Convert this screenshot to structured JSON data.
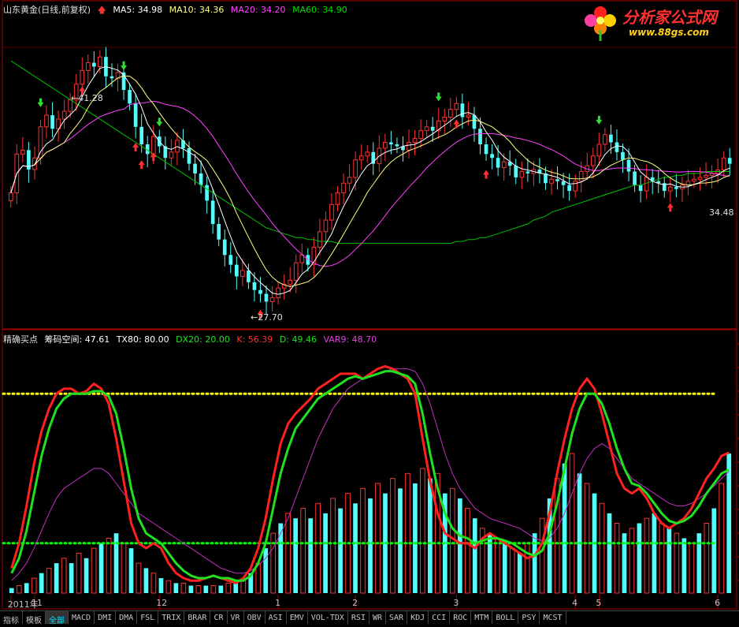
{
  "header": {
    "stock": "山东黄金(日线,前复权)",
    "ma5": "MA5: 34.98",
    "ma10": "MA10: 34.36",
    "ma20": "MA20: 34.20",
    "ma60": "MA60: 34.90"
  },
  "indicator_header": {
    "name": "精确买点",
    "zone": "筹码空间: 47.61",
    "tx80": "TX80: 80.00",
    "dx20": "DX20: 20.00",
    "k": "K: 56.39",
    "d": "D: 49.46",
    "var9": "VAR9: 48.70"
  },
  "logo": {
    "title": "分析家公式网",
    "url": "www.88gs.com"
  },
  "price_labels": {
    "high": "41.28",
    "low": "27.70",
    "last": "34.48"
  },
  "colors": {
    "up": "#ff3030",
    "down": "#54fcfc",
    "ma5": "#ffffff",
    "ma10": "#ffff80",
    "ma20": "#ff40ff",
    "ma60": "#00c000",
    "k": "#ff2020",
    "d": "#20e020",
    "var9": "#c030c0",
    "ref": "#ffff00",
    "ref2": "#00ff00"
  },
  "tabs": [
    "指标",
    "模板",
    "全部",
    "MACD",
    "DMI",
    "DMA",
    "FSL",
    "TRIX",
    "BRAR",
    "CR",
    "VR",
    "OBV",
    "ASI",
    "EMV",
    "VOL-TDX",
    "RSI",
    "WR",
    "SAR",
    "KDJ",
    "CCI",
    "ROC",
    "MTM",
    "BOLL",
    "PSY",
    "MCST"
  ],
  "active_tab": "全部",
  "chart_data": [
    {
      "type": "candlestick",
      "title": "山东黄金(日线,前复权)",
      "ylim": [
        27,
        43
      ],
      "x_labels": [
        {
          "label": "2011年",
          "index": 0
        },
        {
          "label": "11",
          "index": 4
        },
        {
          "label": "12",
          "index": 25
        },
        {
          "label": "1",
          "index": 45
        },
        {
          "label": "2",
          "index": 58
        },
        {
          "label": "3",
          "index": 75
        },
        {
          "label": "4",
          "index": 95
        },
        {
          "label": "5",
          "index": 99
        },
        {
          "label": "6",
          "index": 119
        }
      ],
      "close": [
        33.8,
        35.8,
        36.0,
        35.0,
        35.6,
        37.2,
        37.8,
        37.1,
        37.6,
        38.0,
        38.6,
        39.4,
        40.1,
        40.5,
        40.3,
        40.8,
        39.8,
        39.7,
        40.0,
        39.1,
        38.4,
        37.2,
        36.3,
        35.8,
        36.7,
        36.2,
        35.6,
        35.9,
        36.5,
        36.1,
        35.3,
        34.8,
        34.2,
        33.4,
        32.2,
        31.4,
        30.6,
        30.1,
        29.5,
        29.8,
        29.2,
        28.8,
        28.6,
        28.2,
        28.4,
        28.9,
        29.1,
        29.3,
        30.2,
        30.6,
        30.1,
        31.0,
        31.8,
        32.4,
        33.2,
        33.8,
        34.3,
        34.6,
        35.5,
        35.7,
        35.9,
        35.3,
        36.1,
        36.4,
        36.3,
        36.2,
        36.0,
        36.4,
        36.6,
        37.0,
        37.2,
        37.0,
        37.5,
        37.7,
        38.1,
        38.4,
        37.7,
        37.8,
        37.1,
        36.3,
        35.8,
        35.6,
        35.1,
        35.4,
        35.2,
        34.6,
        34.9,
        34.8,
        35.0,
        34.8,
        34.3,
        34.5,
        34.4,
        34.2,
        33.9,
        34.4,
        34.9,
        35.2,
        35.7,
        36.3,
        36.8,
        36.4,
        35.9,
        35.5,
        34.9,
        34.2,
        33.9,
        34.6,
        34.4,
        34.3,
        33.9,
        34.1,
        34.0,
        34.2,
        34.4,
        34.5,
        34.6,
        34.7,
        34.8,
        34.98,
        35.6,
        35.3
      ],
      "ma60": [
        40.6,
        40.4,
        40.2,
        40.0,
        39.8,
        39.6,
        39.4,
        39.2,
        39.0,
        38.8,
        38.6,
        38.4,
        38.2,
        38.0,
        37.8,
        37.6,
        37.4,
        37.2,
        37.0,
        36.8,
        36.6,
        36.4,
        36.2,
        36.0,
        35.8,
        35.6,
        35.4,
        35.2,
        35.0,
        34.8,
        34.6,
        34.4,
        34.2,
        34.0,
        33.8,
        33.6,
        33.4,
        33.2,
        33.0,
        32.8,
        32.6,
        32.4,
        32.2,
        32.0,
        31.9,
        31.8,
        31.7,
        31.6,
        31.5,
        31.5,
        31.4,
        31.4,
        31.3,
        31.3,
        31.3,
        31.2,
        31.2,
        31.2,
        31.2,
        31.2,
        31.2,
        31.2,
        31.2,
        31.2,
        31.2,
        31.2,
        31.2,
        31.2,
        31.2,
        31.2,
        31.2,
        31.2,
        31.2,
        31.2,
        31.2,
        31.3,
        31.3,
        31.4,
        31.4,
        31.5,
        31.5,
        31.6,
        31.7,
        31.8,
        31.9,
        32.0,
        32.1,
        32.2,
        32.4,
        32.5,
        32.6,
        32.8,
        32.9,
        33.0,
        33.1,
        33.2,
        33.3,
        33.4,
        33.5,
        33.6,
        33.7,
        33.8,
        33.9,
        34.0,
        34.1,
        34.2,
        34.2,
        34.3,
        34.4,
        34.5,
        34.6,
        34.6,
        34.7,
        34.7,
        34.8,
        34.8,
        34.8,
        34.9,
        34.9,
        34.9,
        34.9,
        34.9
      ],
      "buy_markers": [
        12,
        21,
        22,
        24,
        42,
        75,
        80,
        111
      ],
      "sell_markers": [
        5,
        19,
        25,
        72,
        99
      ]
    },
    {
      "type": "line",
      "title": "精确买点",
      "ylim": [
        0,
        100
      ],
      "reference_lines": [
        {
          "name": "TX80",
          "value": 80
        },
        {
          "name": "DX20",
          "value": 20
        }
      ],
      "k": [
        10,
        20,
        35,
        52,
        65,
        74,
        80,
        82,
        82,
        80,
        81,
        84,
        82,
        76,
        62,
        45,
        28,
        20,
        18,
        20,
        18,
        12,
        8,
        6,
        5,
        5,
        6,
        7,
        6,
        5,
        4,
        6,
        10,
        18,
        30,
        46,
        60,
        68,
        72,
        75,
        78,
        82,
        84,
        86,
        88,
        88,
        88,
        86,
        88,
        90,
        91,
        90,
        88,
        86,
        80,
        62,
        45,
        32,
        24,
        22,
        20,
        20,
        18,
        22,
        24,
        22,
        20,
        18,
        16,
        14,
        15,
        20,
        32,
        48,
        62,
        74,
        82,
        86,
        82,
        72,
        60,
        48,
        42,
        40,
        42,
        38,
        32,
        28,
        26,
        28,
        30,
        34,
        40,
        46,
        50,
        55,
        56.39
      ],
      "d": [
        8,
        14,
        25,
        40,
        55,
        66,
        74,
        78,
        80,
        80,
        80,
        81,
        81,
        79,
        72,
        58,
        42,
        30,
        24,
        22,
        20,
        16,
        12,
        9,
        7,
        6,
        6,
        7,
        6,
        6,
        5,
        5,
        7,
        12,
        20,
        34,
        48,
        58,
        66,
        70,
        74,
        78,
        80,
        82,
        84,
        86,
        87,
        86,
        87,
        88,
        89,
        89,
        88,
        87,
        84,
        72,
        56,
        42,
        32,
        26,
        23,
        22,
        20,
        21,
        22,
        22,
        21,
        20,
        18,
        16,
        15,
        17,
        24,
        36,
        50,
        64,
        74,
        80,
        80,
        76,
        68,
        58,
        50,
        44,
        43,
        40,
        36,
        32,
        29,
        28,
        29,
        31,
        35,
        40,
        44,
        48,
        49.46
      ],
      "var9": [
        5,
        8,
        12,
        18,
        25,
        32,
        38,
        42,
        44,
        46,
        48,
        50,
        50,
        48,
        44,
        40,
        36,
        32,
        30,
        28,
        26,
        24,
        22,
        20,
        18,
        16,
        14,
        12,
        10,
        9,
        8,
        8,
        9,
        11,
        14,
        18,
        24,
        30,
        38,
        46,
        54,
        62,
        68,
        74,
        78,
        82,
        84,
        86,
        87,
        88,
        89,
        90,
        90,
        90,
        89,
        84,
        76,
        66,
        56,
        48,
        42,
        38,
        34,
        32,
        30,
        29,
        28,
        27,
        26,
        24,
        22,
        21,
        22,
        26,
        32,
        40,
        48,
        54,
        58,
        60,
        58,
        54,
        50,
        46,
        44,
        42,
        40,
        38,
        36,
        35,
        35,
        36,
        38,
        40,
        43,
        46,
        48.7
      ],
      "bars": [
        2,
        3,
        4,
        6,
        8,
        10,
        12,
        14,
        12,
        16,
        14,
        18,
        20,
        22,
        24,
        20,
        18,
        12,
        10,
        8,
        6,
        5,
        4,
        4,
        3,
        3,
        3,
        3,
        3,
        4,
        4,
        5,
        8,
        12,
        18,
        24,
        28,
        32,
        30,
        34,
        30,
        36,
        32,
        38,
        34,
        40,
        36,
        42,
        38,
        44,
        40,
        46,
        42,
        48,
        44,
        50,
        46,
        48,
        40,
        42,
        38,
        34,
        30,
        26,
        24,
        22,
        20,
        18,
        16,
        20,
        24,
        30,
        38,
        46,
        52,
        56,
        48,
        44,
        40,
        36,
        32,
        28,
        24,
        26,
        28,
        30,
        32,
        28,
        26,
        24,
        22,
        20,
        24,
        28,
        34,
        44,
        56
      ]
    }
  ]
}
